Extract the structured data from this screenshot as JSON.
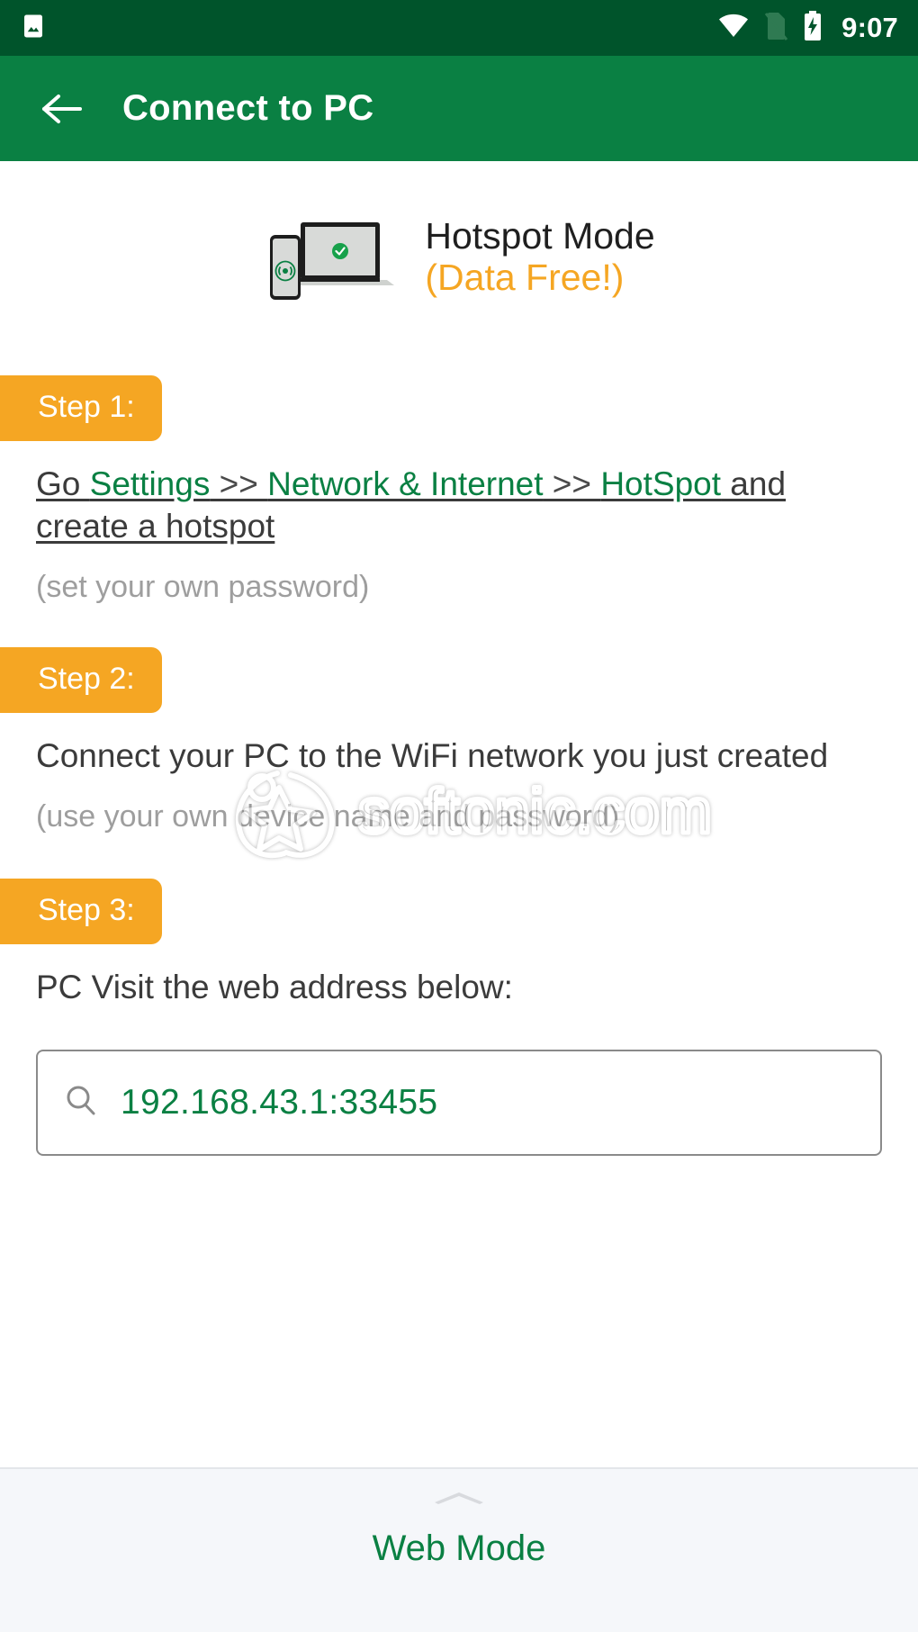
{
  "statusbar": {
    "time": "9:07",
    "icons": [
      "photo-icon",
      "wifi-icon",
      "no-sim-icon",
      "battery-charging-icon"
    ]
  },
  "appbar": {
    "back_label": "back-arrow",
    "title": "Connect to PC"
  },
  "mode": {
    "title": "Hotspot Mode",
    "subtitle": "(Data Free!)"
  },
  "steps": [
    {
      "badge": "Step 1:",
      "line_parts": {
        "p1": "Go ",
        "p2": "Settings",
        "p3": " >> ",
        "p4": "Network & Internet",
        "p5": " >> ",
        "p6": "HotSpot",
        "p7": " and create a hotspot"
      },
      "note": "(set your own password)"
    },
    {
      "badge": "Step 2:",
      "text": "Connect your PC to the WiFi network you just created",
      "note": "(use your own device name and password)"
    },
    {
      "badge": "Step 3:",
      "text": "PC Visit the web address below:",
      "note": ""
    }
  ],
  "url_field": {
    "icon": "search-icon",
    "value": "192.168.43.1:33455"
  },
  "watermark": {
    "text": "softonic.com"
  },
  "bottom_sheet": {
    "handle": "chevron-up-handle",
    "label": "Web Mode"
  },
  "colors": {
    "status_bar": "#00542B",
    "app_bar": "#0A8043",
    "accent_green": "#0A8043",
    "accent_orange": "#F5A623",
    "muted_text": "#9e9e9e",
    "body_text": "#3b3b3b",
    "sheet_bg": "#F5F7FA"
  }
}
